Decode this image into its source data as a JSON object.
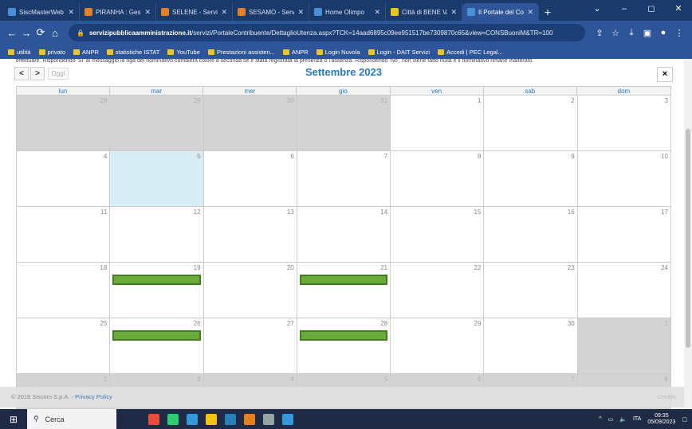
{
  "browser": {
    "tabs": [
      {
        "title": "SiscMasterWeb - Si",
        "color": "#4a90d9"
      },
      {
        "title": "PIRANHA : Gestione",
        "color": "#e67e22"
      },
      {
        "title": "SELENE - Servizi De",
        "color": "#e67e22"
      },
      {
        "title": "SESAMO - Servizi D",
        "color": "#e67e22"
      },
      {
        "title": "Home Olimpo",
        "color": "#4a90d9"
      },
      {
        "title": "Città di BENE VAGI",
        "color": "#f1c40f"
      },
      {
        "title": "Il Portale del Contr",
        "color": "#4a90d9",
        "active": true
      }
    ],
    "url_host": "servizipubblicaamministrazione.it",
    "url_path": "/servizi/PortaleContribuente/DettaglioUtenza.aspx?TCK=14aad6895c09ee951517be7309870c65&view=CONSBuoniM&TR=100",
    "bookmarks": [
      "utilità",
      "privato",
      "ANPR",
      "statistiche ISTAT",
      "YouTube",
      "Prestazioni assisten...",
      "ANPR",
      "Login Nuvola",
      "Login - DAIT Servizi",
      "Accedi | PEC Legal..."
    ]
  },
  "page": {
    "notice": "effettuare. Rispondendo 'Sì' al messaggio la riga del nominativo cambierà colore a seconda se è stata registrata la presenza o l'assenza. Rispondendo 'No', non viene fatto nulla e il nominativo rimane inalterato.",
    "prev_label": "<",
    "next_label": ">",
    "today_label": "Oggi",
    "month_title": "Settembre 2023",
    "close_label": "×",
    "weekdays": [
      "lun",
      "mar",
      "mer",
      "gio",
      "ven",
      "sab",
      "dom"
    ],
    "days": [
      {
        "n": "28",
        "other": true
      },
      {
        "n": "29",
        "other": true
      },
      {
        "n": "30",
        "other": true
      },
      {
        "n": "31",
        "other": true
      },
      {
        "n": "1"
      },
      {
        "n": "2"
      },
      {
        "n": "3"
      },
      {
        "n": "4"
      },
      {
        "n": "5",
        "today": true
      },
      {
        "n": "6"
      },
      {
        "n": "7"
      },
      {
        "n": "8"
      },
      {
        "n": "9"
      },
      {
        "n": "10"
      },
      {
        "n": "11"
      },
      {
        "n": "12"
      },
      {
        "n": "13"
      },
      {
        "n": "14"
      },
      {
        "n": "15"
      },
      {
        "n": "16"
      },
      {
        "n": "17"
      },
      {
        "n": "18"
      },
      {
        "n": "19",
        "event": true
      },
      {
        "n": "20"
      },
      {
        "n": "21",
        "event": true
      },
      {
        "n": "22"
      },
      {
        "n": "23"
      },
      {
        "n": "24"
      },
      {
        "n": "25"
      },
      {
        "n": "26",
        "event": true
      },
      {
        "n": "27"
      },
      {
        "n": "28",
        "event": true
      },
      {
        "n": "29"
      },
      {
        "n": "30"
      },
      {
        "n": "1",
        "other": true
      },
      {
        "n": "2",
        "other": true
      },
      {
        "n": "3",
        "other": true
      },
      {
        "n": "4",
        "other": true
      },
      {
        "n": "5",
        "other": true
      },
      {
        "n": "6",
        "other": true
      },
      {
        "n": "7",
        "other": true
      },
      {
        "n": "8",
        "other": true
      }
    ],
    "footer_copyright": "© 2018 Siscom S.p.A. - ",
    "footer_privacy": "Privacy Policy",
    "footer_credits": "Credits"
  },
  "taskbar": {
    "search_label": "Cerca",
    "app_colors": [
      "#e74c3c",
      "#2ecc71",
      "#3498db",
      "#f1c40f",
      "#2980b9",
      "#e67e22",
      "#95a5a6",
      "#3498db"
    ],
    "language": "ITA",
    "time": "09:35",
    "date": "05/09/2023"
  }
}
